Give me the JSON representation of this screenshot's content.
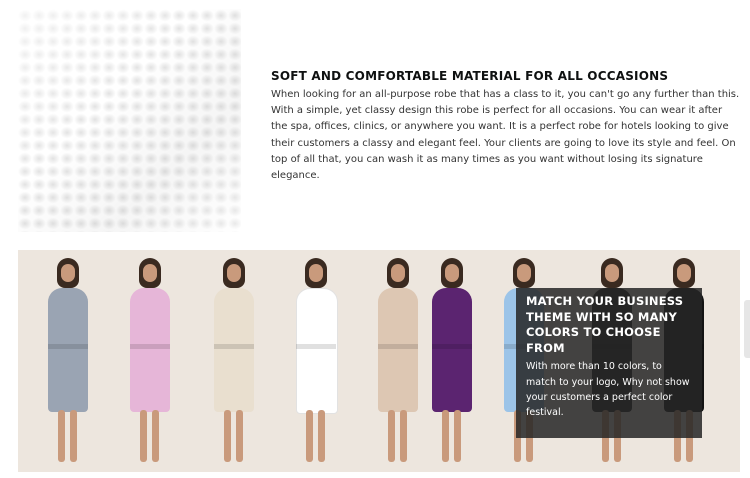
{
  "feature": {
    "title": "SOFT AND COMFORTABLE MATERIAL FOR ALL OCCASIONS",
    "body": "When looking for an all-purpose robe that has a class to it, you can't go any further than this. With a simple, yet classy design this robe is perfect for all occasions. You can wear it after the spa, offices, clinics, or anywhere you want. It is a perfect robe for hotels looking to give their customers a classy and elegant feel. Your clients are going to love its style and feel. On top of all that, you can wash it as many times as you want without losing its signature elegance."
  },
  "banner": {
    "overlay_title": "MATCH YOUR BUSINESS THEME WITH SO MANY COLORS TO CHOOSE FROM",
    "overlay_body": "With more than 10 colors, to match to your logo, Why not show your customers a perfect color festival.",
    "robe_colors": [
      "#9aa4b3",
      "#e6b6d8",
      "#e9dfcf",
      "#ffffff",
      "#ddc7b3",
      "#5b2470",
      "#9cc4e8",
      "#1d1d1d",
      "#141414"
    ]
  }
}
